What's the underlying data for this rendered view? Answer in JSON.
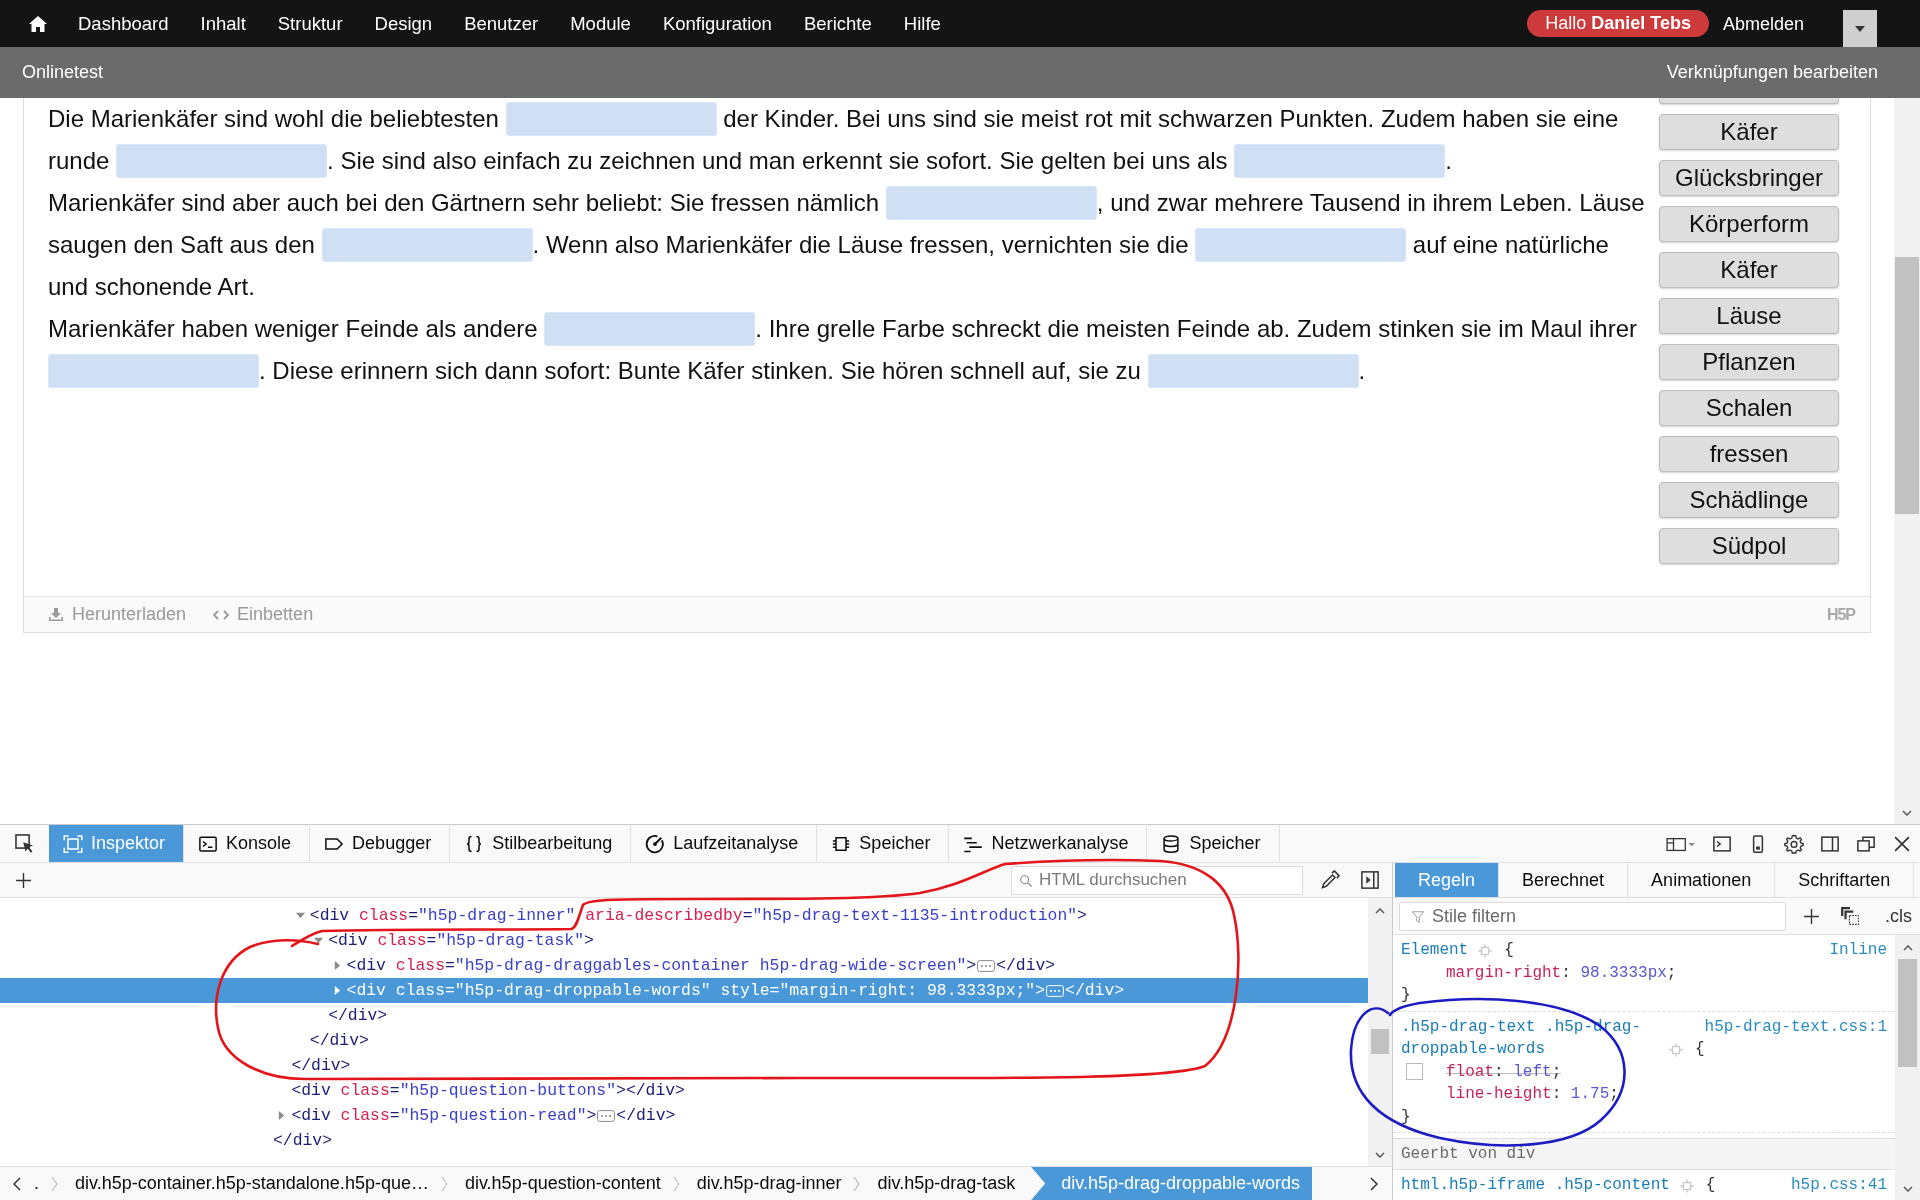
{
  "top_nav": {
    "items": [
      "Dashboard",
      "Inhalt",
      "Struktur",
      "Design",
      "Benutzer",
      "Module",
      "Konfiguration",
      "Berichte",
      "Hilfe"
    ],
    "greeting": "Hallo **Daniel Tebs**",
    "logout": "Abmelden"
  },
  "title_bar": {
    "title": "Onlinetest",
    "action": "Verknüpfungen bearbeiten"
  },
  "exercise": {
    "paragraphs": [
      {
        "lines": [
          [
            {
              "kind": "text",
              "text": "Die Marienkäfer sind wohl die beliebtesten "
            },
            {
              "kind": "blank"
            },
            {
              "kind": "text",
              "text": " der Kinder. Bei uns sind sie meist rot mit schwarzen Punkten. Zudem haben sie eine"
            }
          ],
          [
            {
              "kind": "text",
              "text": "runde "
            },
            {
              "kind": "blank"
            },
            {
              "kind": "text",
              "text": ". Sie sind also einfach zu zeichnen und man erkennt sie sofort. Sie gelten bei uns als "
            },
            {
              "kind": "blank"
            },
            {
              "kind": "text",
              "text": "."
            }
          ]
        ]
      },
      {
        "lines": [
          [
            {
              "kind": "text",
              "text": "Marienkäfer sind aber auch bei den Gärtnern sehr beliebt: Sie fressen nämlich "
            },
            {
              "kind": "blank"
            },
            {
              "kind": "text",
              "text": ", und zwar mehrere Tausend in ihrem Leben. Läuse"
            }
          ],
          [
            {
              "kind": "text",
              "text": "saugen den Saft aus den "
            },
            {
              "kind": "blank"
            },
            {
              "kind": "text",
              "text": ". Wenn also Marienkäfer die Läuse fressen, vernichten sie die "
            },
            {
              "kind": "blank"
            },
            {
              "kind": "text",
              "text": " auf eine natürliche"
            }
          ],
          [
            {
              "kind": "text",
              "text": "und schonende Art."
            }
          ]
        ]
      },
      {
        "lines": [
          [
            {
              "kind": "text",
              "text": "Marienkäfer haben weniger Feinde als andere "
            },
            {
              "kind": "blank"
            },
            {
              "kind": "text",
              "text": ". Ihre grelle Farbe schreckt die meisten Feinde ab. Zudem stinken sie im Maul ihrer"
            }
          ],
          [
            {
              "kind": "blank"
            },
            {
              "kind": "text",
              "text": ". Diese erinnern sich dann sofort: Bunte Käfer stinken. Sie hören schnell auf, sie zu "
            },
            {
              "kind": "blank"
            },
            {
              "kind": "text",
              "text": "."
            }
          ]
        ]
      }
    ],
    "word_bank": {
      "clipped_top": true,
      "words": [
        "Käfer",
        "Glücksbringer",
        "Körperform",
        "Käfer",
        "Läuse",
        "Pflanzen",
        "Schalen",
        "fressen",
        "Schädlinge",
        "Südpol"
      ]
    },
    "footer": {
      "download": "Herunterladen",
      "embed": "Einbetten",
      "logo": "H5P"
    }
  },
  "devtools": {
    "tabs": [
      {
        "label": "Inspektor",
        "selected": true
      },
      {
        "label": "Konsole",
        "selected": false
      },
      {
        "label": "Debugger",
        "selected": false
      },
      {
        "label": "Stilbearbeitung",
        "selected": false
      },
      {
        "label": "Laufzeitanalyse",
        "selected": false
      },
      {
        "label": "Speicher",
        "selected": false
      },
      {
        "label": "Netzwerkanalyse",
        "selected": false
      },
      {
        "label": "Speicher",
        "selected": false
      }
    ],
    "search": {
      "placeholder": "HTML durchsuchen"
    },
    "html_tree": [
      {
        "kind": "clipped",
        "close": "</div>",
        "children": [
          {
            "kind": "clipped",
            "close": "</div>",
            "children": [
              {
                "kind": "container",
                "open": "<div class=\"h5p-drag-inner\" aria-describedby=\"h5p-drag-text-1135-introduction\">",
                "expanded": true,
                "selected": false,
                "close": "</div>",
                "children": [
                  {
                    "kind": "container",
                    "open": "<div class=\"h5p-drag-task\">",
                    "expanded": true,
                    "selected": false,
                    "close": "</div>",
                    "children": [
                      {
                        "kind": "container",
                        "open": "<div class=\"h5p-drag-draggables-container h5p-drag-wide-screen\">",
                        "expanded": false,
                        "selected": false,
                        "close": "</div>"
                      },
                      {
                        "kind": "container",
                        "open": "<div class=\"h5p-drag-droppable-words\" style=\"margin-right: 98.3333px;\">",
                        "expanded": false,
                        "selected": true,
                        "close": "</div>"
                      }
                    ]
                  }
                ]
              }
            ]
          },
          {
            "kind": "empty",
            "open": "<div class=\"h5p-question-buttons\">",
            "selected": false,
            "close": "</div>"
          },
          {
            "kind": "container",
            "open": "<div class=\"h5p-question-read\">",
            "expanded": false,
            "selected": false,
            "close": "</div>"
          }
        ]
      }
    ],
    "breadcrumbs": [
      {
        "label": ".",
        "selected": false
      },
      {
        "label": "div.h5p-container.h5p-standalone.h5p-que…",
        "selected": false
      },
      {
        "label": "div.h5p-question-content",
        "selected": false
      },
      {
        "label": "div.h5p-drag-inner",
        "selected": false
      },
      {
        "label": "div.h5p-drag-task",
        "selected": false
      },
      {
        "label": "div.h5p-drag-droppable-words",
        "selected": true
      }
    ],
    "sidebar_tabs": [
      {
        "label": "Regeln",
        "selected": true
      },
      {
        "label": "Berechnet",
        "selected": false
      },
      {
        "label": "Animationen",
        "selected": false
      },
      {
        "label": "Schriftarten",
        "selected": false
      }
    ],
    "filter": {
      "placeholder": "Stile filtern"
    },
    "classes_button": ".cls",
    "rules": [
      {
        "kind": "rule",
        "selector": "Element",
        "open": "{",
        "source": "Inline",
        "declarations": [
          {
            "text": "margin-right: 98.3333px;",
            "enabled": true
          }
        ],
        "close": "}"
      },
      {
        "kind": "rule",
        "selector": ".h5p-drag-text .h5p-drag-droppable-words",
        "open": "{",
        "source": "h5p-drag-text.css:1",
        "declarations": [
          {
            "text": "float: left;",
            "enabled": false
          },
          {
            "text": "line-height: 1.75;",
            "enabled": true
          }
        ],
        "close": "}"
      },
      {
        "kind": "header",
        "label": "Geerbt von div"
      },
      {
        "kind": "rule",
        "selector": "html.h5p-iframe .h5p-content",
        "open": "{",
        "source": "h5p.css:41"
      }
    ]
  },
  "annotations": [
    {
      "kind": "tree-loop",
      "color": "#e3151a"
    },
    {
      "kind": "rule-circle",
      "color": "#1c1cc4"
    }
  ]
}
